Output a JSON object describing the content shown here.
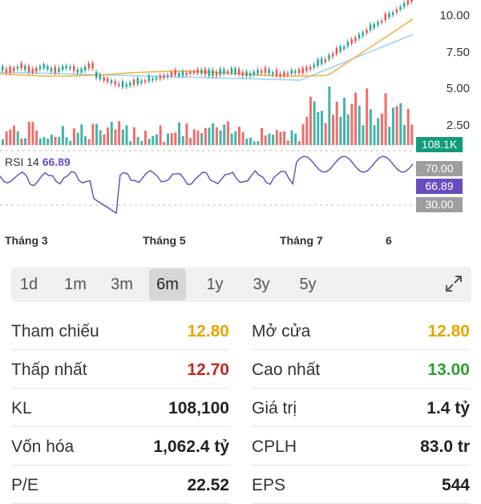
{
  "chart": {
    "price_axis": [
      "10.00",
      "7.50",
      "5.00",
      "2.50"
    ],
    "volume_badge": "108.1K",
    "rsi_label": "RSI 14",
    "rsi_value": "66.89",
    "rsi_levels": [
      "70.00",
      "66.89",
      "30.00"
    ],
    "months": [
      "Tháng 3",
      "Tháng 5",
      "Tháng 7",
      "6"
    ],
    "colors": {
      "up": "#26a69a",
      "down": "#ef5350",
      "ma_short": "#f0b44c",
      "ma_long": "#9cd3f2",
      "rsi": "#5b4db5",
      "volume_badge": "#129a7c",
      "rsi_badge": "#6a4cc0",
      "level_badge": "#9e9e9e"
    }
  },
  "ranges": {
    "items": [
      "1d",
      "1m",
      "3m",
      "6m",
      "1y",
      "3y",
      "5y"
    ],
    "active": "6m",
    "expand_icon": "expand-arrows-icon"
  },
  "stats": {
    "left": [
      {
        "label": "Tham chiếu",
        "value": "12.80",
        "color": "#e6a700"
      },
      {
        "label": "Thấp nhất",
        "value": "12.70",
        "color": "#c62828"
      },
      {
        "label": "KL",
        "value": "108,100",
        "color": "#222222"
      },
      {
        "label": "Vốn hóa",
        "value": "1,062.4 tỷ",
        "color": "#222222"
      },
      {
        "label": "P/E",
        "value": "22.52",
        "color": "#222222"
      }
    ],
    "right": [
      {
        "label": "Mở cửa",
        "value": "12.80",
        "color": "#e6a700"
      },
      {
        "label": "Cao nhất",
        "value": "13.00",
        "color": "#2e9e2e"
      },
      {
        "label": "Giá trị",
        "value": "1.4 tỷ",
        "color": "#222222"
      },
      {
        "label": "CPLH",
        "value": "83.0 tr",
        "color": "#222222"
      },
      {
        "label": "EPS",
        "value": "544",
        "color": "#222222"
      }
    ]
  }
}
